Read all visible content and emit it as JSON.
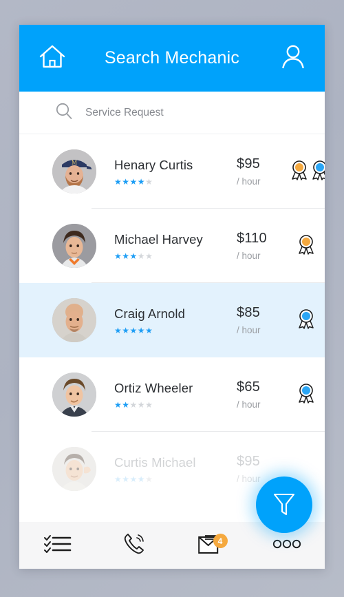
{
  "theme": {
    "accent": "#00A2FB",
    "badge_orange": "#F5A93F",
    "badge_blue": "#2BA6F5",
    "star_on": "#1E9EF5",
    "star_off": "#D3D6DA",
    "highlight_row": "#E3F2FD",
    "navbar_bg": "#F6F6F7",
    "text_primary": "#2C2F33",
    "text_muted": "#9A9DA2"
  },
  "header": {
    "title": "Search Mechanic",
    "home_icon": "home-icon",
    "profile_icon": "user-icon"
  },
  "search": {
    "icon": "search-icon",
    "placeholder": "Service Request",
    "value": ""
  },
  "list": {
    "price_unit": "/ hour",
    "items": [
      {
        "name": "Henary Curtis",
        "price": "$95",
        "unit": "/ hour",
        "rating": 4,
        "max_rating": 5,
        "badges": [
          "orange",
          "blue"
        ],
        "selected": false,
        "faded": false
      },
      {
        "name": "Michael Harvey",
        "price": "$110",
        "unit": "/ hour",
        "rating": 3,
        "max_rating": 5,
        "badges": [
          "orange"
        ],
        "selected": false,
        "faded": false
      },
      {
        "name": "Craig Arnold",
        "price": "$85",
        "unit": "/ hour",
        "rating": 5,
        "max_rating": 5,
        "badges": [
          "blue"
        ],
        "selected": true,
        "faded": false
      },
      {
        "name": "Ortiz Wheeler",
        "price": "$65",
        "unit": "/ hour",
        "rating": 2,
        "max_rating": 5,
        "badges": [
          "blue"
        ],
        "selected": false,
        "faded": false
      },
      {
        "name": "Curtis Michael",
        "price": "$95",
        "unit": "/ hour",
        "rating": 4,
        "max_rating": 5,
        "badges": [],
        "selected": false,
        "faded": true
      }
    ]
  },
  "fab": {
    "icon": "filter-funnel-icon",
    "label": "Filter"
  },
  "navbar": {
    "items": [
      {
        "icon": "checklist-icon",
        "badge": ""
      },
      {
        "icon": "phone-ringing-icon",
        "badge": ""
      },
      {
        "icon": "envelope-icon",
        "badge": "4"
      },
      {
        "icon": "more-dots-icon",
        "badge": ""
      }
    ]
  }
}
